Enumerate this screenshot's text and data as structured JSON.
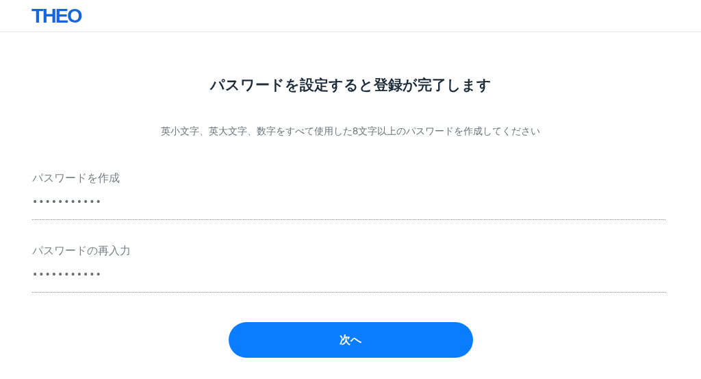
{
  "header": {
    "logo": "THEO"
  },
  "title": "パスワードを設定すると登録が完了します",
  "instructions": "英小文字、英大文字、数字をすべて使用した8文字以上のパスワードを作成してください",
  "fields": [
    {
      "label": "パスワードを作成",
      "value": "•••••••••••"
    },
    {
      "label": "パスワードの再入力",
      "value": "•••••••••••"
    }
  ],
  "button": {
    "label": "次へ"
  }
}
